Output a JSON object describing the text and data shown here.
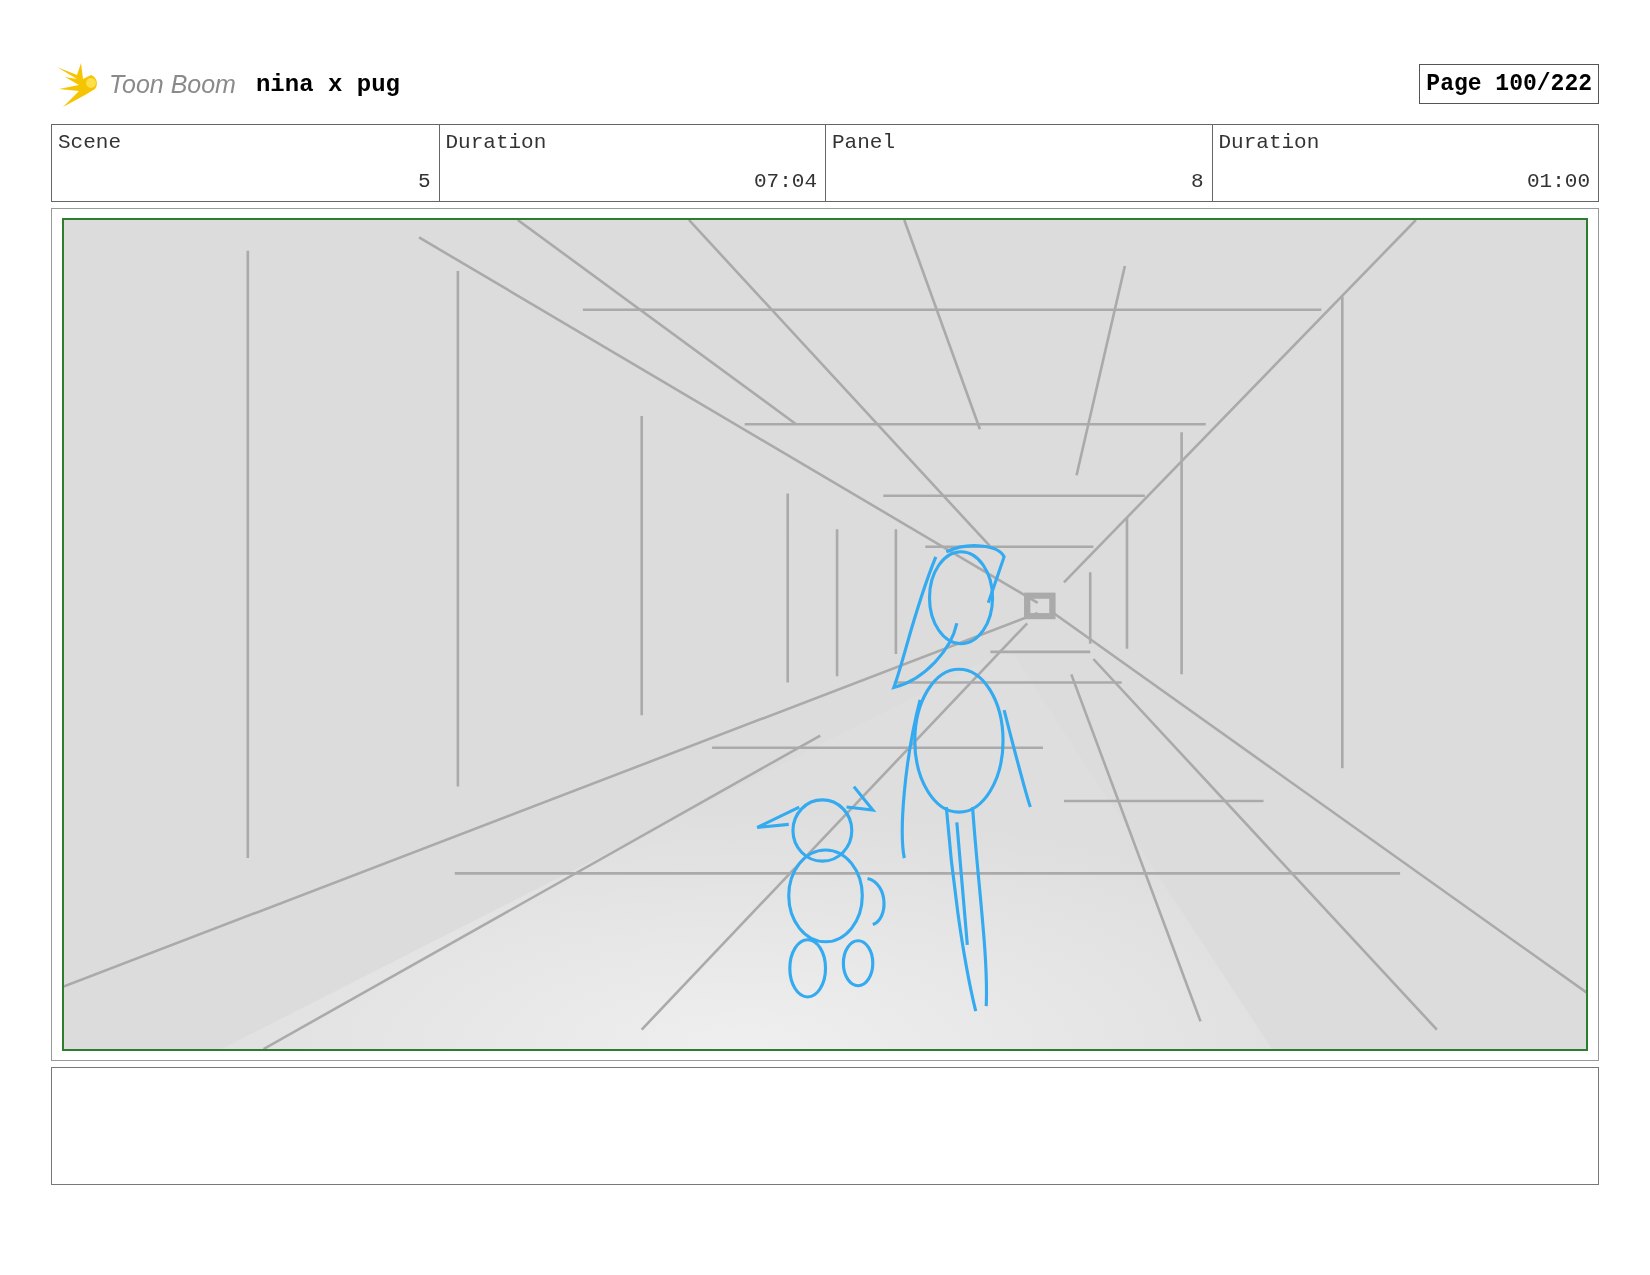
{
  "header": {
    "logo_text": "Toon Boom",
    "project_title": "nina x pug",
    "page": "Page 100/222"
  },
  "info_table": {
    "columns": [
      "Scene",
      "Duration",
      "Panel",
      "Duration"
    ],
    "rows": [
      [
        "5",
        "07:04",
        "8",
        "01:00"
      ]
    ]
  }
}
